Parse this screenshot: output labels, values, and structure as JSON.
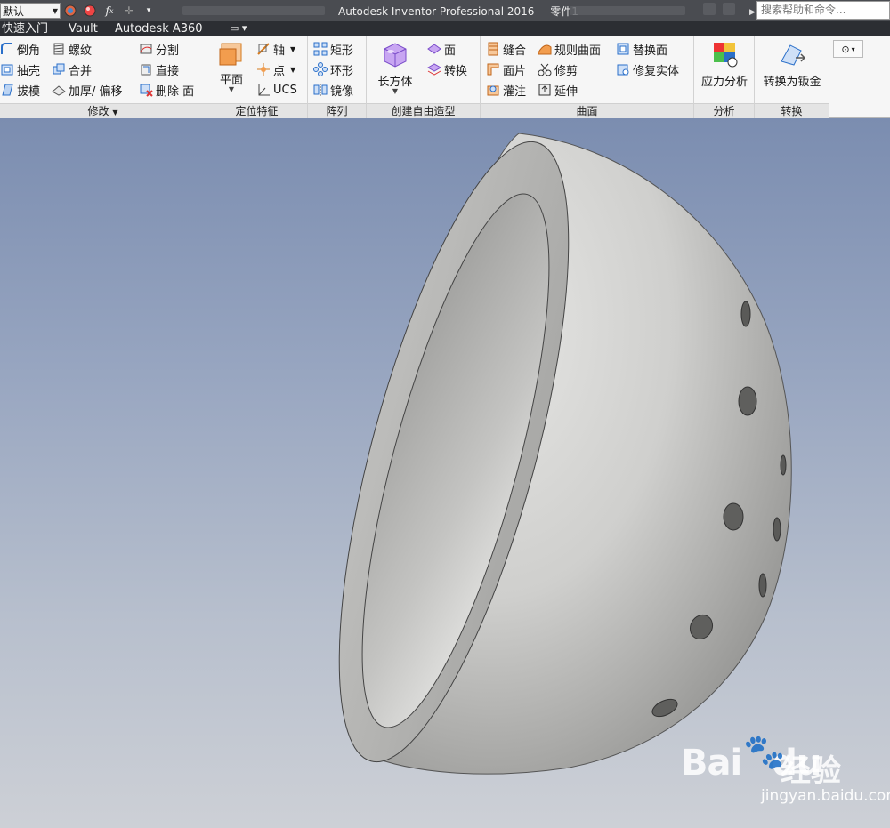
{
  "titlebar": {
    "style_combo": "默认",
    "app_title": "Autodesk Inventor Professional 2016",
    "doc_title": "零件1",
    "search_placeholder": "搜索帮助和命令..."
  },
  "tabs": [
    {
      "label": "快速入门"
    },
    {
      "label": "Vault"
    },
    {
      "label": "Autodesk A360"
    }
  ],
  "ribbon": {
    "modify": {
      "label": "修改",
      "items": [
        {
          "label": "倒角",
          "icon": "fillet-icon"
        },
        {
          "label": "抽壳",
          "icon": "shell-icon"
        },
        {
          "label": "拔模",
          "icon": "draft-icon"
        },
        {
          "label": "螺纹",
          "icon": "thread-icon"
        },
        {
          "label": "合并",
          "icon": "combine-icon"
        },
        {
          "label": "加厚/ 偏移",
          "icon": "thicken-icon"
        },
        {
          "label": "分割",
          "icon": "split-icon"
        },
        {
          "label": "直接",
          "icon": "direct-edit-icon"
        },
        {
          "label": "删除 面",
          "icon": "delete-face-icon"
        }
      ]
    },
    "work_features": {
      "label": "定位特征",
      "plane": "平面",
      "axis": "轴",
      "point": "点",
      "ucs": "UCS"
    },
    "pattern": {
      "label": "阵列",
      "rect": "矩形",
      "circ": "环形",
      "mirror": "镜像"
    },
    "freeform": {
      "label": "创建自由造型",
      "box": "长方体",
      "face": "面",
      "convert": "转换"
    },
    "surface": {
      "label": "曲面",
      "stitch": "缝合",
      "patch": "面片",
      "sculpt": "灌注",
      "ruled": "规则曲面",
      "trim": "修剪",
      "extend": "延伸",
      "replace": "替换面",
      "repair": "修复实体"
    },
    "analysis": {
      "label": "分析",
      "stress": "应力分析"
    },
    "convert": {
      "label": "转换",
      "sheetmetal": "转换为钣金"
    }
  },
  "watermark": {
    "brand": "Bai",
    "brand_tail": "du",
    "cn": "经验",
    "url": "jingyan.baidu.com"
  },
  "colors": {
    "titlebar": "#4a4c51",
    "tabbar": "#2c2e33",
    "ribbon": "#f6f6f6",
    "viewport_top": "#7b8db0",
    "viewport_bottom": "#cdd0d6",
    "part": "#c9c9c7"
  }
}
